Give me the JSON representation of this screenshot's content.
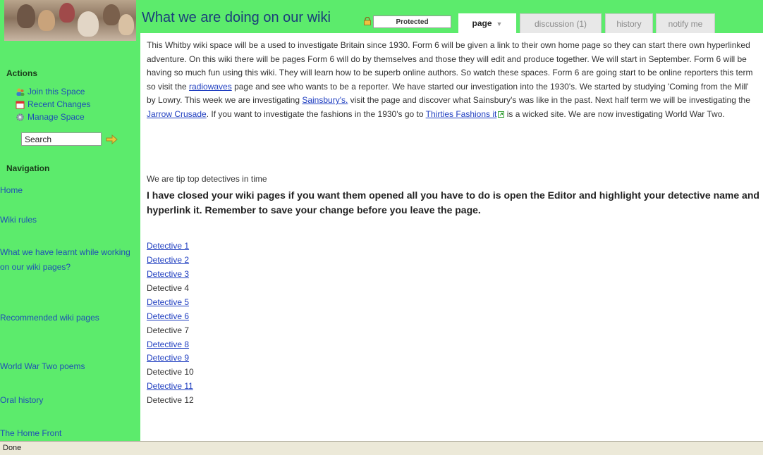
{
  "sidebar": {
    "actions_heading": "Actions",
    "actions": [
      {
        "label": "Join this Space",
        "icon": "users-icon"
      },
      {
        "label": "Recent Changes",
        "icon": "calendar-icon"
      },
      {
        "label": "Manage Space",
        "icon": "gear-icon"
      }
    ],
    "search": {
      "value": "Search"
    },
    "navigation_heading": "Navigation",
    "nav_items": [
      "Home",
      "Wiki rules",
      "What we have learnt while working on our wiki pages?",
      "Recommended wiki pages",
      "World War Two poems",
      "Oral history",
      "The Home Front"
    ]
  },
  "header": {
    "title": "What we are doing on our wiki",
    "protected_label": "Protected",
    "tabs": [
      {
        "label": "page",
        "active": true
      },
      {
        "label": "discussion (1)",
        "active": false
      },
      {
        "label": "history",
        "active": false
      },
      {
        "label": "notify me",
        "active": false
      }
    ]
  },
  "content": {
    "p1": "This Whitby wiki space will be a used to investigate Britain since 1930. Form 6 will be given a link to their own home page so they can start there own hyperlinked adventure. On this wiki there will be pages Form 6 will do by themselves and those they will edit and produce together. We will start in September. Form 6 will be having so much fun using this wiki. They will learn how to be superb online authors. So watch these spaces. Form 6 are going start to be online reporters this term so visit the ",
    "link_radiowaves": "radiowaves",
    "p2": " page and see who wants to be a reporter. We have started our investigation into the 1930's. We started by studying 'Coming from the Mill' by Lowry. This week we are investigating ",
    "link_sainsburys": "Sainsbury's.",
    "p3": " visit the page and discover what Sainsbury's was like in the past. Next half term we will be investigating the ",
    "link_jarrow": "Jarrow Crusade",
    "p4": ". If you want to investigate the fashions in the 1930's go to ",
    "link_thirties": "Thirties Fashions it",
    "p5": " is a wicked site. We are now investigating World War Two.",
    "tip_top": "We are tip top detectives in time",
    "bold_notice": "I have closed your wiki pages if you want them opened all you have to do is open the Editor and highlight your detective name and hyperlink it. Remember to save your change before you leave the page.",
    "detectives": [
      {
        "label": "Detective 1",
        "link": true
      },
      {
        "label": "Detective 2",
        "link": true
      },
      {
        "label": "Detective 3",
        "link": true
      },
      {
        "label": "Detective 4",
        "link": false
      },
      {
        "label": "Detective 5",
        "link": true
      },
      {
        "label": "Detective 6",
        "link": true
      },
      {
        "label": "Detective 7",
        "link": false
      },
      {
        "label": "Detective 8",
        "link": true
      },
      {
        "label": "Detective 9",
        "link": true
      },
      {
        "label": "Detective 10",
        "link": false
      },
      {
        "label": "Detective 11",
        "link": true
      },
      {
        "label": "Detective 12",
        "link": false
      }
    ]
  },
  "status_bar": {
    "text": "Done"
  },
  "colors": {
    "page_bg": "#5ceb6c",
    "link": "#1f3ec0",
    "title": "#1a3d7a"
  }
}
